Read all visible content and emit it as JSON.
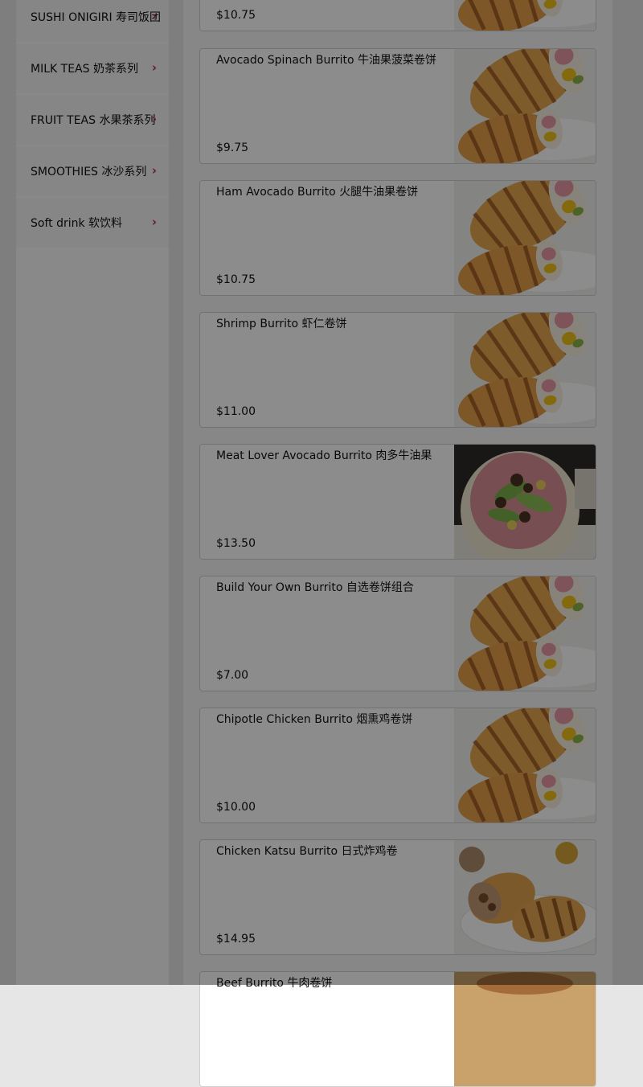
{
  "sidebar": {
    "items": [
      {
        "label": "SUSHI ONIGIRI 寿司饭团"
      },
      {
        "label": "MILK TEAS 奶茶系列"
      },
      {
        "label": "FRUIT TEAS 水果茶系列"
      },
      {
        "label": "SMOOTHIES 冰沙系列"
      },
      {
        "label": "Soft drink 软饮料"
      }
    ]
  },
  "menu": {
    "partial_top": {
      "price": "$10.75"
    },
    "items": [
      {
        "name": "Avocado Spinach Burrito 牛油果菠菜卷饼",
        "price": "$9.75",
        "image": "burrito-photo"
      },
      {
        "name": "Ham Avocado Burrito 火腿牛油果卷饼",
        "price": "$10.75",
        "image": "burrito-photo"
      },
      {
        "name": "Shrimp Burrito 虾仁卷饼",
        "price": "$11.00",
        "image": "burrito-photo"
      },
      {
        "name": "Meat Lover Avocado Burrito 肉多牛油果",
        "price": "$13.50",
        "image": "open-burrito-photo"
      },
      {
        "name": "Build Your Own Burrito 自选卷饼组合",
        "price": "$7.00",
        "image": "burrito-photo"
      },
      {
        "name": "Chipotle Chicken Burrito 烟熏鸡卷饼",
        "price": "$10.00",
        "image": "burrito-photo"
      },
      {
        "name": "Chicken Katsu Burrito 日式炸鸡卷",
        "price": "$14.95",
        "image": "katsu-burrito-photo"
      },
      {
        "name": "Beef Burrito 牛肉卷饼",
        "price": "",
        "image": "beef-burrito-photo"
      }
    ]
  }
}
